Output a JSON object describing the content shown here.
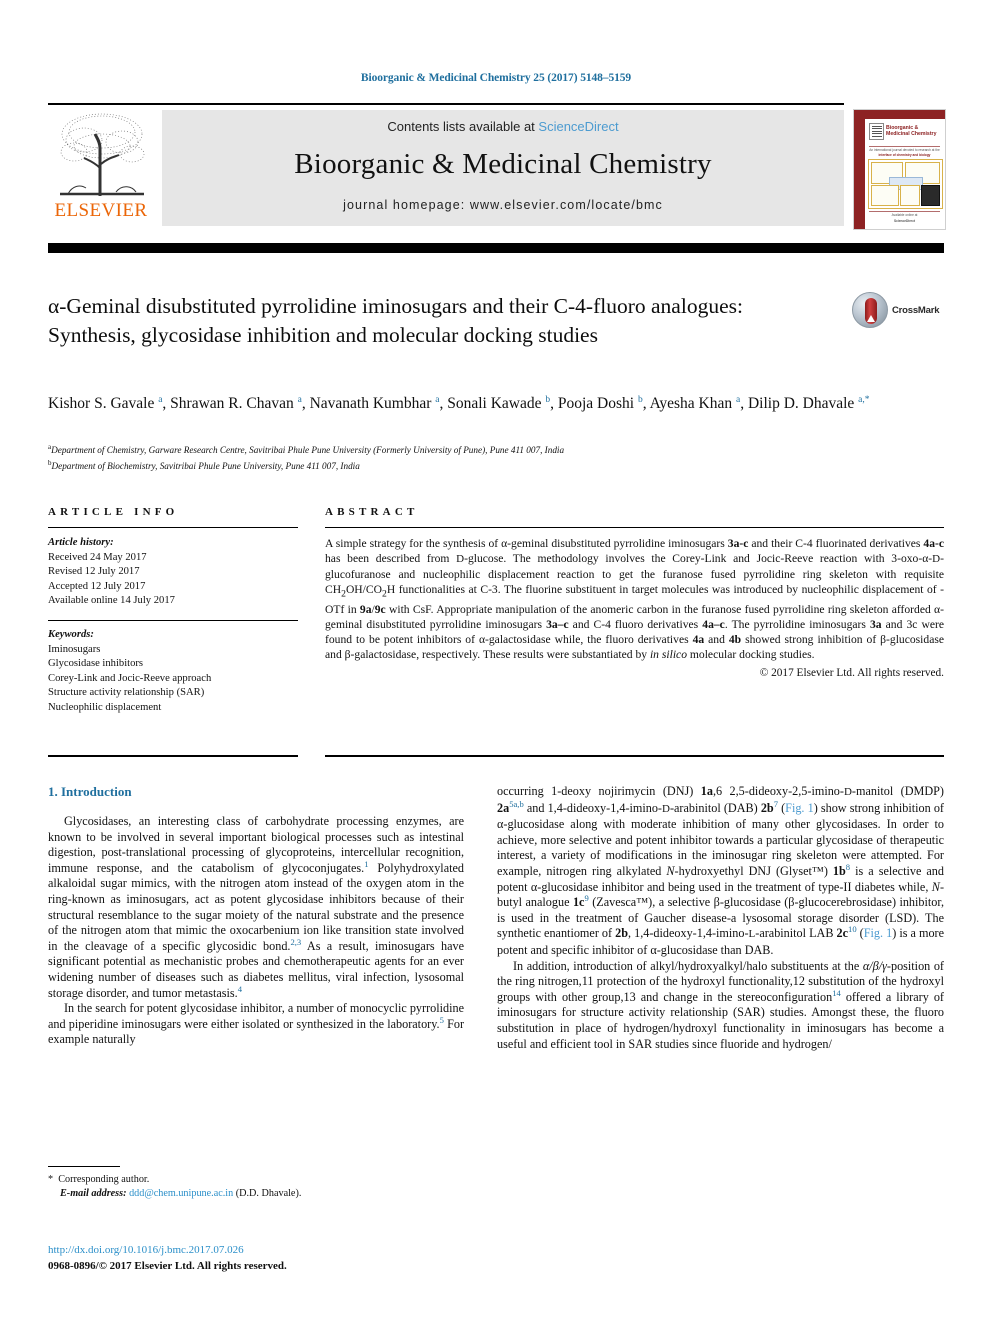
{
  "running_head": "Bioorganic & Medicinal Chemistry 25 (2017) 5148–5159",
  "header": {
    "publisher": "ELSEVIER",
    "contents_prefix": "Contents lists available at ",
    "contents_link": "ScienceDirect",
    "journal_title": "Bioorganic & Medicinal Chemistry",
    "homepage": "journal homepage: www.elsevier.com/locate/bmc",
    "cover": {
      "title": "Bioorganic & Medicinal Chemistry",
      "subtitle": "An international journal devoted to research at the",
      "subtitle2": "interface of chemistry and biology",
      "footer1": "Available online at",
      "footer2": "ScienceDirect"
    }
  },
  "crossmark": {
    "label": "CrossMark"
  },
  "article": {
    "title": "α-Geminal disubstituted pyrrolidine iminosugars and their C-4-fluoro analogues: Synthesis, glycosidase inhibition and molecular docking studies",
    "authors_html": "Kishor S. Gavale <sup>a</sup>, Shrawan R. Chavan <sup>a</sup>, Navanath Kumbhar <sup>a</sup>, Sonali Kawade <sup>b</sup>, Pooja Doshi <sup>b</sup>, Ayesha Khan <sup>a</sup>, Dilip D. Dhavale <sup>a,*</sup>",
    "affiliation_a": "Department of Chemistry, Garware Research Centre, Savitribai Phule Pune University (Formerly University of Pune), Pune 411 007, India",
    "affiliation_b": "Department of Biochemistry, Savitribai Phule Pune University, Pune 411 007, India"
  },
  "article_info": {
    "heading": "ARTICLE INFO",
    "history_label": "Article history:",
    "history": [
      "Received 24 May 2017",
      "Revised 12 July 2017",
      "Accepted 12 July 2017",
      "Available online 14 July 2017"
    ],
    "keywords_label": "Keywords:",
    "keywords": [
      "Iminosugars",
      "Glycosidase inhibitors",
      "Corey-Link and Jocic-Reeve approach",
      "Structure activity relationship (SAR)",
      "Nucleophilic displacement"
    ]
  },
  "abstract": {
    "heading": "ABSTRACT",
    "text": "A simple strategy for the synthesis of α-geminal disubstituted pyrrolidine iminosugars 3a-c and their C-4 fluorinated derivatives 4a-c has been described from D-glucose. The methodology involves the Corey-Link and Jocic-Reeve reaction with 3-oxo-α-D-glucofuranose and nucleophilic displacement reaction to get the furanose fused pyrrolidine ring skeleton with requisite CH2OH/CO2H functionalities at C-3. The fluorine substituent in target molecules was introduced by nucleophilic displacement of -OTf in 9a/9c with CsF. Appropriate manipulation of the anomeric carbon in the furanose fused pyrrolidine ring skeleton afforded α-geminal disubstituted pyrrolidine iminosugars 3a–c and C-4 fluoro derivatives 4a–c. The pyrrolidine iminosugars 3a and 3c were found to be potent inhibitors of α-galactosidase while, the fluoro derivatives 4a and 4b showed strong inhibition of β-glucosidase and β-galactosidase, respectively. These results were substantiated by in silico molecular docking studies.",
    "copyright": "© 2017 Elsevier Ltd. All rights reserved."
  },
  "body": {
    "section_heading": "1. Introduction",
    "left_paragraph_1": "Glycosidases, an interesting class of carbohydrate processing enzymes, are known to be involved in several important biological processes such as intestinal digestion, post-translational processing of glycoproteins, intercellular recognition, immune response, and the catabolism of glycoconjugates.1 Polyhydroxylated alkaloidal sugar mimics, with the nitrogen atom instead of the oxygen atom in the ring-known as iminosugars, act as potent glycosidase inhibitors because of their structural resemblance to the sugar moiety of the natural substrate and the presence of the nitrogen atom that mimic the oxocarbenium ion like transition state involved in the cleavage of a specific glycosidic bond.2,3 As a result, iminosugars have significant potential as mechanistic probes and chemotherapeutic agents for an ever widening number of diseases such as diabetes mellitus, viral infection, lysosomal storage disorder, and tumor metastasis.4",
    "left_paragraph_2": "In the search for potent glycosidase inhibitor, a number of monocyclic pyrrolidine and piperidine iminosugars were either isolated or synthesized in the laboratory.5 For example naturally",
    "right_paragraph_1": "occurring 1-deoxy nojirimycin (DNJ) 1a,6 2,5-dideoxy-2,5-imino-D-manitol (DMDP) 2a5a,b and 1,4-dideoxy-1,4-imino-D-arabinitol (DAB) 2b7 (Fig. 1) show strong inhibition of α-glucosidase along with moderate inhibition of many other glycosidases. In order to achieve, more selective and potent inhibitor towards a particular glycosidase of therapeutic interest, a variety of modifications in the iminosugar ring skeleton were attempted. For example, nitrogen ring alkylated N-hydroxyethyl DNJ (Glyset™) 1b8 is a selective and potent α-glucosidase inhibitor and being used in the treatment of type-II diabetes while, N-butyl analogue 1c9 (Zavesca™), a selective β-glucosidase (β-glucocerebrosidase) inhibitor, is used in the treatment of Gaucher disease-a lysosomal storage disorder (LSD). The synthetic enantiomer of 2b, 1,4-dideoxy-1,4-imino-L-arabinitol LAB 2c10 (Fig. 1) is a more potent and specific inhibitor of α-glucosidase than DAB.",
    "right_paragraph_2": "In addition, introduction of alkyl/hydroxyalkyl/halo substituents at the α/β/γ-position of the ring nitrogen,11 protection of the hydroxyl functionality,12 substitution of the hydroxyl groups with other group,13 and change in the stereoconfiguration14 offered a library of iminosugars for structure activity relationship (SAR) studies. Amongst these, the fluoro substitution in place of hydrogen/hydroxyl functionality in iminosugars has become a useful and efficient tool in SAR studies since fluoride and hydrogen/"
  },
  "footnote": {
    "corresponding": "Corresponding author.",
    "email_label": "E-mail address:",
    "email": "ddd@chem.unipune.ac.in",
    "email_owner": "(D.D. Dhavale)."
  },
  "footer": {
    "doi": "http://dx.doi.org/10.1016/j.bmc.2017.07.026",
    "issn_line": "0968-0896/© 2017 Elsevier Ltd. All rights reserved."
  },
  "colors": {
    "link_blue": "#1f6f9e",
    "light_link": "#4c9bd0",
    "elsevier_orange": "#eb6608",
    "cover_maroon": "#8d2223"
  }
}
